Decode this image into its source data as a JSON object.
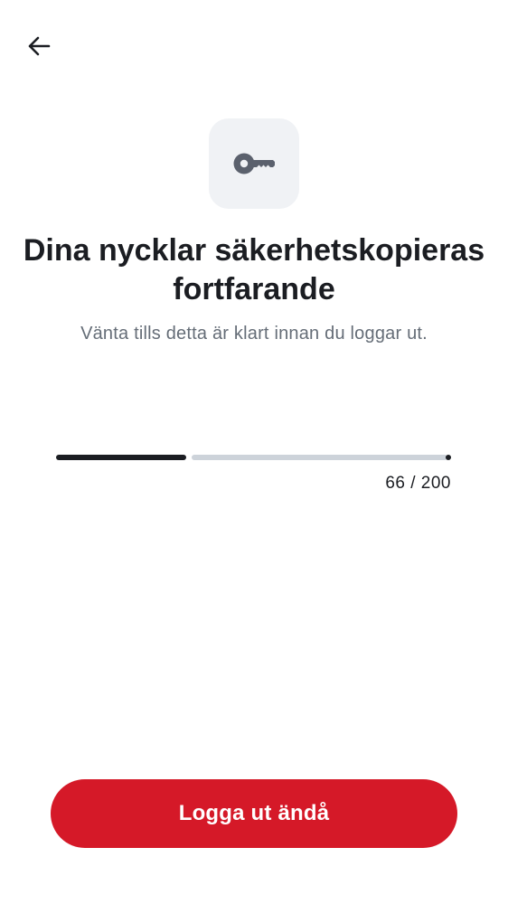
{
  "header": {
    "back_icon": "arrow-left-icon"
  },
  "hero": {
    "icon": "key-icon",
    "icon_tile_color": "#f0f2f5",
    "title": "Dina nycklar säkerhetskopieras fortfarande",
    "subtitle": "Vänta tills detta är klart innan du loggar ut."
  },
  "progress": {
    "current": 66,
    "total": 200,
    "label": "66 / 200",
    "fill_color": "#1b1d22",
    "track_color": "#cdd3da"
  },
  "actions": {
    "logout_label": "Logga ut ändå",
    "logout_color": "#d51928"
  }
}
